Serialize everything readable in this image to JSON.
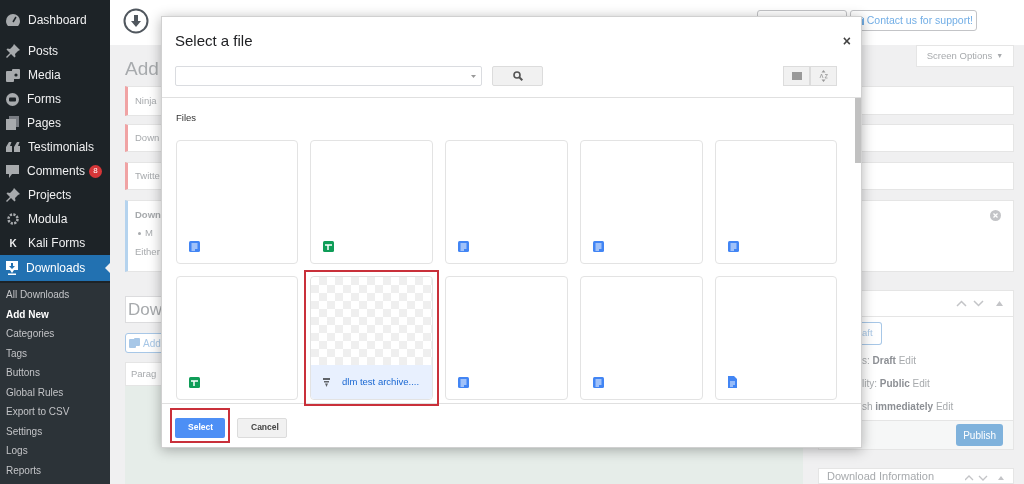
{
  "sidebar": {
    "items": [
      {
        "label": "Dashboard",
        "selected": false
      },
      {
        "label": "Posts",
        "selected": false
      },
      {
        "label": "Media",
        "selected": false
      },
      {
        "label": "Forms",
        "selected": false
      },
      {
        "label": "Pages",
        "selected": false
      },
      {
        "label": "Testimonials",
        "selected": false
      },
      {
        "label": "Comments",
        "badge": "8",
        "selected": false
      },
      {
        "label": "Projects",
        "selected": false
      },
      {
        "label": "Modula",
        "selected": false
      },
      {
        "label": "Kali Forms",
        "icon_text": "K",
        "selected": false
      },
      {
        "label": "Downloads",
        "selected": true
      }
    ],
    "submenu": [
      {
        "label": "All Downloads",
        "selected": false
      },
      {
        "label": "Add New",
        "selected": true
      },
      {
        "label": "Categories",
        "selected": false
      },
      {
        "label": "Tags",
        "selected": false
      },
      {
        "label": "Buttons",
        "selected": false
      },
      {
        "label": "Global Rules",
        "selected": false
      },
      {
        "label": "Export to CSV",
        "selected": false
      },
      {
        "label": "Settings",
        "selected": false
      },
      {
        "label": "Logs",
        "selected": false
      },
      {
        "label": "Reports",
        "selected": false
      }
    ]
  },
  "header": {
    "support_button": "Contact us for support!",
    "screen_options": "Screen Options",
    "screen_options_caret": "▼"
  },
  "page_left": {
    "title": "Add",
    "notices": [
      {
        "kind": "error",
        "text": "Ninja"
      },
      {
        "kind": "error",
        "text": "Down"
      },
      {
        "kind": "error",
        "text": "Twitte"
      },
      {
        "kind": "info",
        "heading": "Down",
        "bullet": "M",
        "text": "Either"
      }
    ],
    "title_field": "Dow",
    "add_media": "Add",
    "format": "Parag"
  },
  "page_right": {
    "draft_button": "aft",
    "status_lines": [
      "s: **Draft** Edit",
      "lity: **Public** Edit",
      "sh **immediately** Edit"
    ],
    "publish_button": "Publish",
    "next_panel": "Download Information"
  },
  "modal": {
    "title": "Select a file",
    "close": "×",
    "section": "Files",
    "files": [
      {
        "kind": "doc",
        "selected": false,
        "highlighted": false
      },
      {
        "kind": "sheet",
        "selected": false,
        "highlighted": false
      },
      {
        "kind": "doc",
        "selected": false,
        "highlighted": false
      },
      {
        "kind": "doc",
        "selected": false,
        "highlighted": false
      },
      {
        "kind": "doc",
        "selected": false,
        "highlighted": false
      },
      {
        "kind": "sheet",
        "selected": false,
        "highlighted": false
      },
      {
        "kind": "archive",
        "label": "dlm test archive....",
        "selected": true,
        "highlighted": true
      },
      {
        "kind": "doc",
        "selected": false,
        "highlighted": false
      },
      {
        "kind": "doc",
        "selected": false,
        "highlighted": false
      },
      {
        "kind": "file",
        "selected": false,
        "highlighted": false
      }
    ],
    "buttons": [
      {
        "label": "Select",
        "kind": "primary",
        "highlighted": true
      },
      {
        "label": "Cancel",
        "kind": "secondary",
        "highlighted": false
      }
    ]
  }
}
